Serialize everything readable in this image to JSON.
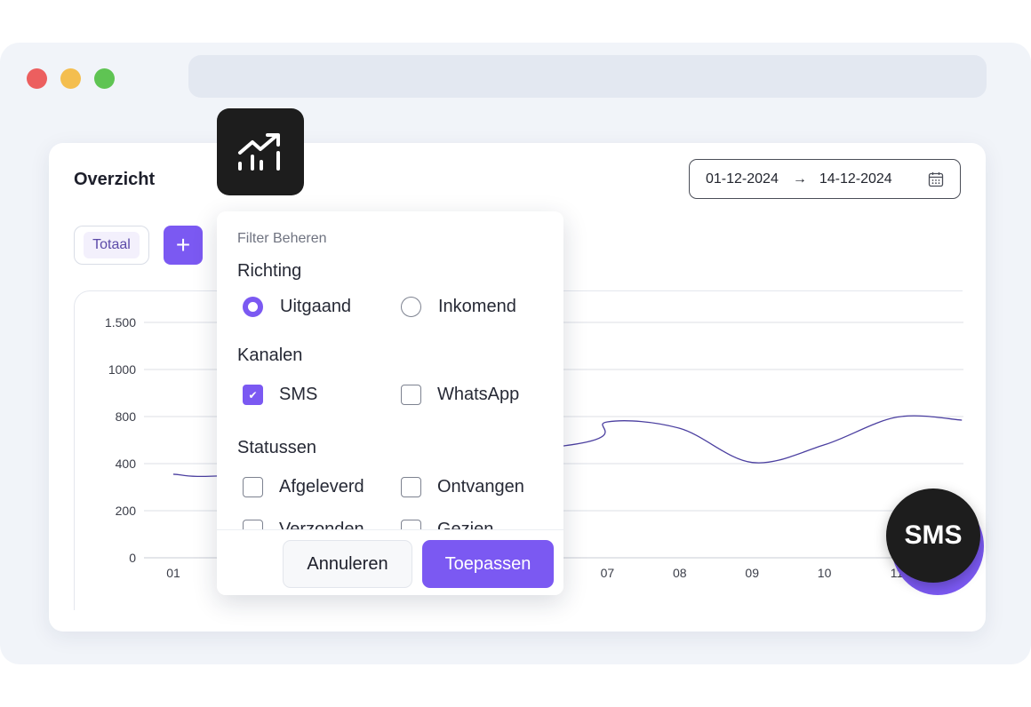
{
  "card": {
    "title": "Overzicht",
    "date_from": "01-12-2024",
    "date_arrow": "→",
    "date_to": "14-12-2024",
    "calendar_icon": "calendar-icon",
    "chip_label": "Totaal",
    "add_label": "+"
  },
  "chart_data": {
    "type": "line",
    "y_ticks": [
      "1.500",
      "1000",
      "800",
      "400",
      "200",
      "0"
    ],
    "x_ticks": [
      "01",
      "07",
      "08",
      "09",
      "10",
      "11"
    ],
    "series": [
      {
        "color": "#4b3fa0",
        "points": [
          [
            1,
            355
          ],
          [
            2,
            355
          ],
          [
            6.5,
            560
          ],
          [
            7,
            755
          ],
          [
            8,
            700
          ],
          [
            9,
            410
          ],
          [
            10,
            560
          ],
          [
            11,
            795
          ],
          [
            11.9,
            770
          ]
        ]
      }
    ],
    "grid": true
  },
  "popup": {
    "heading": "Filter Beheren",
    "richting_label": "Richting",
    "uitgaand_label": "Uitgaand",
    "inkomend_label": "Inkomend",
    "kanalen_label": "Kanalen",
    "sms_label": "SMS",
    "whatsapp_label": "WhatsApp",
    "statussen_label": "Statussen",
    "afgeleverd_label": "Afgeleverd",
    "ontvangen_label": "Ontvangen",
    "verzonden_label": "Verzonden",
    "gezien_label": "Gezien",
    "cancel_label": "Annuleren",
    "apply_label": "Toepassen"
  },
  "badge": {
    "label": "SMS"
  },
  "colors": {
    "accent": "#7b59f2",
    "dark": "#1d1d1d"
  }
}
